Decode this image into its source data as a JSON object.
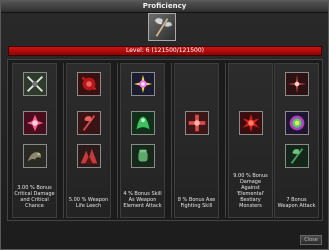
{
  "window": {
    "title": "Proficiency"
  },
  "weapon": {
    "icon": "battle-axe-icon"
  },
  "level": {
    "text": "Level: 6 (121500/121500)",
    "fill_fraction": 1.0,
    "color": "#c80b0b"
  },
  "columns": [
    {
      "icons": [
        "crossed-swords-icon",
        "pink-fire-spell-icon",
        "wyvern-creature-icon"
      ],
      "label": "3.00 % Bonus Critical Damage and Critical Chance"
    },
    {
      "icons": [
        "blood-burst-icon",
        "red-axe-icon",
        "clawed-creature-icon"
      ],
      "label": "5.00 % Weapon Life Leech"
    },
    {
      "icons": [
        "rainbow-burst-icon",
        "green-spirit-icon",
        "green-fist-icon"
      ],
      "label": "4 % Bonus Skill As Weapon Element Attack"
    },
    {
      "icons": [
        "red-cross-rune-icon"
      ],
      "label": "8 % Bonus Axe Fighting Skill"
    },
    {
      "icons": [
        "red-explosion-icon"
      ],
      "label": "9.00 % Bonus Damage Against 'Elemental' Bestiary Monsters"
    },
    {
      "icons": [
        "red-flare-icon",
        "rainbow-blast-icon",
        "green-axe-icon"
      ],
      "label": "7 Bonus Weapon Attack"
    }
  ],
  "buttons": {
    "close": "Close"
  }
}
